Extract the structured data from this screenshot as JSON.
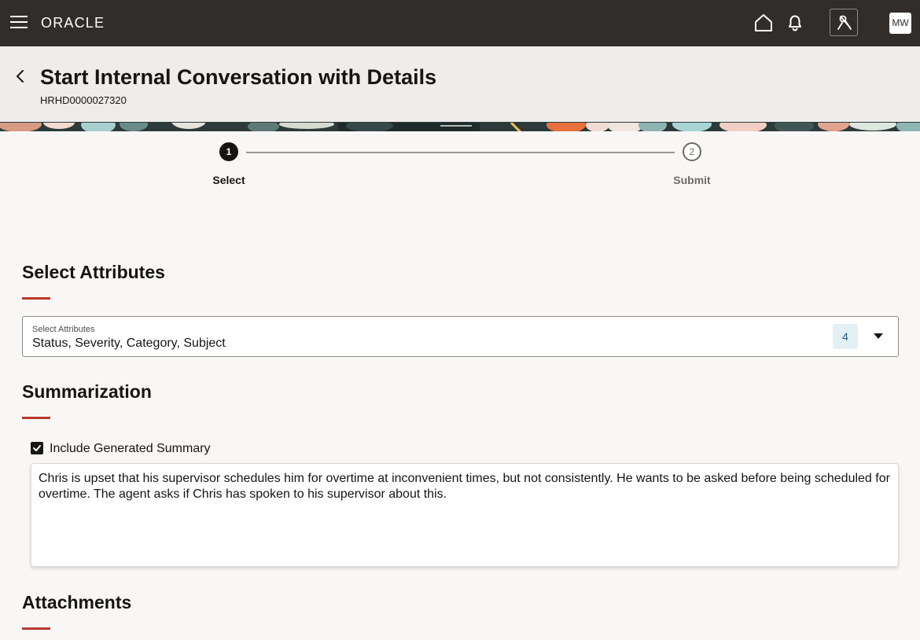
{
  "topbar": {
    "logo": "ORACLE",
    "avatar_initials": "MW"
  },
  "header": {
    "title": "Start Internal Conversation with Details",
    "subtitle": "HRHD0000027320"
  },
  "train": {
    "steps": [
      {
        "number": "1",
        "label": "Select",
        "state": "current"
      },
      {
        "number": "2",
        "label": "Submit",
        "state": "pending"
      }
    ]
  },
  "sections": {
    "attributes": {
      "title": "Select Attributes",
      "field_label": "Select Attributes",
      "field_value": "Status, Severity, Category, Subject",
      "count": "4"
    },
    "summarization": {
      "title": "Summarization",
      "checkbox_label": "Include Generated Summary",
      "checked": true,
      "summary_text": "Chris is upset that his supervisor schedules him for overtime at inconvenient times, but not consistently. He wants to be asked before being scheduled for overtime. The agent asks if Chris has spoken to his supervisor about this."
    },
    "attachments": {
      "title": "Attachments"
    }
  },
  "colors": {
    "topbar_bg": "#312d2a",
    "header_bg": "#eeedeb",
    "accent_underline": "#b8392b",
    "badge_bg": "#e3f0f4"
  },
  "icons": [
    "hamburger-icon",
    "home-icon",
    "bell-icon",
    "assistant-icon",
    "back-chevron-icon",
    "dropdown-arrow-icon",
    "checkmark-icon"
  ]
}
